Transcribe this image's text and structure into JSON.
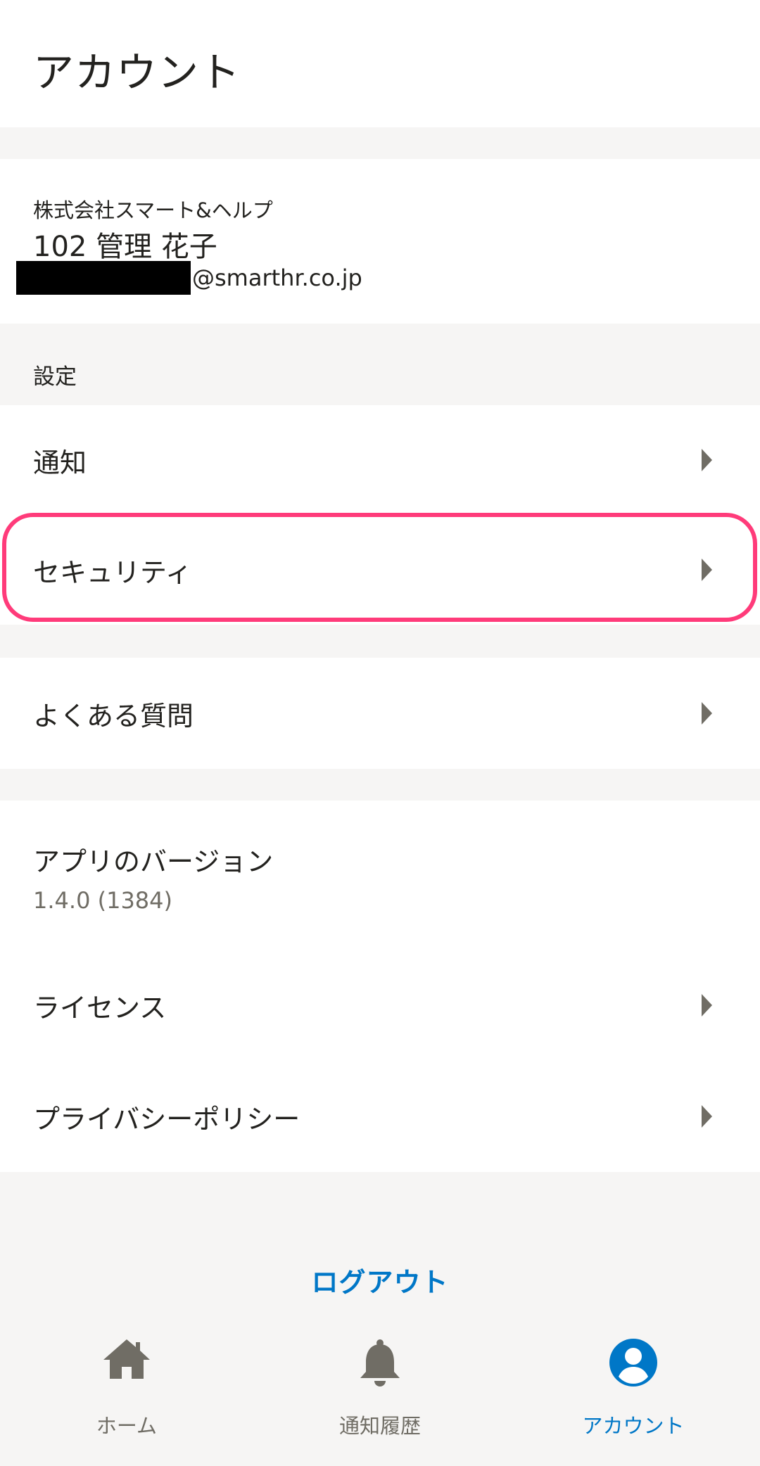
{
  "header": {
    "title": "アカウント"
  },
  "profile": {
    "company": "株式会社スマート&ヘルプ",
    "name": "102 管理 花子",
    "email_domain": "@smarthr.co.jp"
  },
  "settings": {
    "section_label": "設定",
    "items": [
      {
        "label": "通知"
      },
      {
        "label": "セキュリティ"
      }
    ]
  },
  "faq": {
    "label": "よくある質問"
  },
  "about": {
    "version_label": "アプリのバージョン",
    "version_value": "1.4.0 (1384)",
    "license_label": "ライセンス",
    "privacy_label": "プライバシーポリシー"
  },
  "logout_label": "ログアウト",
  "tabbar": {
    "tabs": [
      {
        "label": "ホーム",
        "icon": "home-icon",
        "active": false
      },
      {
        "label": "通知履歴",
        "icon": "bell-icon",
        "active": false
      },
      {
        "label": "アカウント",
        "icon": "account-circle-icon",
        "active": true
      }
    ]
  },
  "colors": {
    "accent": "#0077c7",
    "highlight": "#ff3b7a",
    "background": "#f6f5f4",
    "icon_gray": "#706d65"
  }
}
